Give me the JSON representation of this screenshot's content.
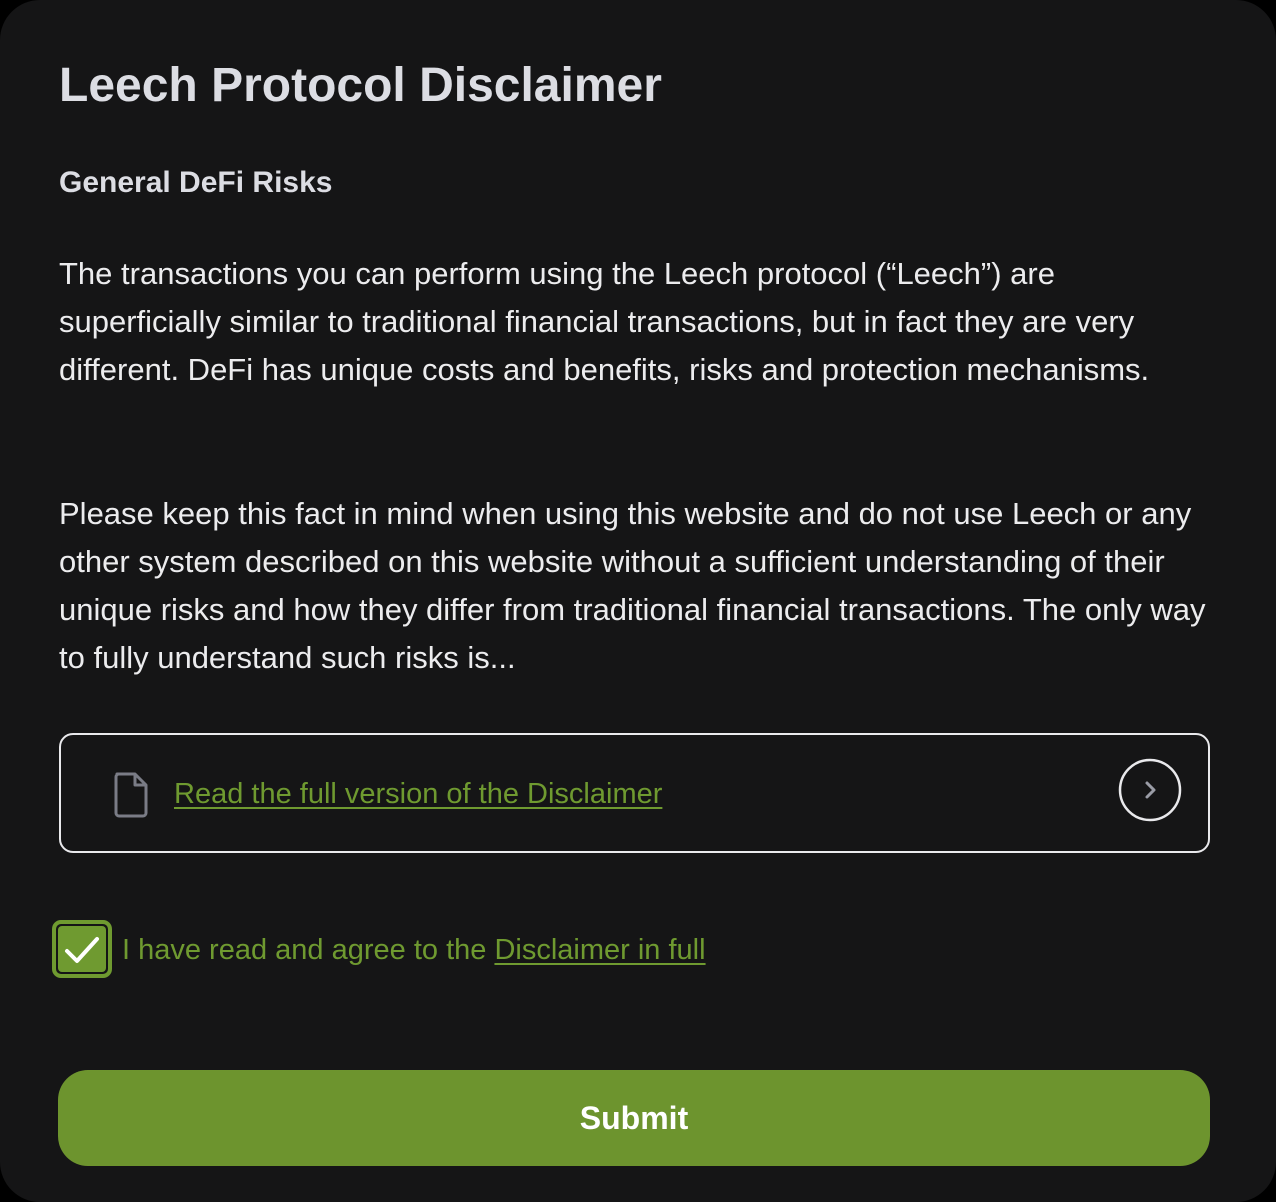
{
  "modal": {
    "title": "Leech Protocol Disclaimer",
    "subtitle": "General DeFi Risks",
    "paragraphs": [
      "The transactions you can perform using the Leech protocol (“Leech”) are superficially similar to traditional financial transactions, but in fact they are very different. DeFi has unique costs and benefits, risks and protection mechanisms.",
      "Please keep this fact in mind when using this website and do not use Leech or any other system described on this website without a sufficient understanding of their unique risks and how they differ from traditional financial transactions. The only way to fully understand such risks is..."
    ]
  },
  "full_disclaimer_link": {
    "label": "Read the full version of the Disclaimer",
    "icon": "document-icon",
    "action_icon": "chevron-right-icon"
  },
  "agreement": {
    "checked": true,
    "text_prefix": "I have read and agree to the ",
    "link_label": "Disclaimer in full"
  },
  "submit": {
    "label": "Submit"
  },
  "colors": {
    "background": "#151516",
    "text": "#ececee",
    "heading": "#dcdde3",
    "accent": "#6f9a30",
    "button": "#6d942e"
  }
}
